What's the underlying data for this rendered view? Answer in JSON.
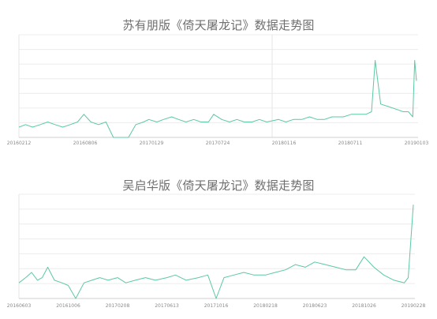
{
  "chart_data": [
    {
      "type": "line",
      "title": "苏有朋版《倚天屠龙记》数据走势图",
      "line_color": "#5cc8a4",
      "grid": "horizontal",
      "x_tick_labels": [
        "20160212",
        "20160806",
        "20170129",
        "20170724",
        "20180116",
        "20180711",
        "20190103"
      ],
      "x": [
        "20160212",
        "20160301",
        "20160320",
        "20160410",
        "20160430",
        "20160520",
        "20160610",
        "20160630",
        "20160720",
        "20160806",
        "20160825",
        "20160915",
        "20161005",
        "20161025",
        "20161115",
        "20161205",
        "20161225",
        "20170115",
        "20170129",
        "20170220",
        "20170310",
        "20170401",
        "20170420",
        "20170510",
        "20170531",
        "20170620",
        "20170710",
        "20170724",
        "20170815",
        "20170905",
        "20170925",
        "20171015",
        "20171105",
        "20171125",
        "20171215",
        "20180116",
        "20180205",
        "20180225",
        "20180320",
        "20180410",
        "20180501",
        "20180520",
        "20180610",
        "20180711",
        "20180801",
        "20180820",
        "20180910",
        "20180925",
        "20181005",
        "20181020",
        "20181110",
        "20181201",
        "20181220",
        "20190103",
        "20190115",
        "20190120",
        "20190125"
      ],
      "y": [
        4,
        5,
        4,
        5,
        6,
        5,
        4,
        5,
        6,
        9,
        6,
        5,
        6,
        0,
        0,
        0,
        5,
        6,
        7,
        6,
        7,
        8,
        7,
        6,
        7,
        6,
        6,
        9,
        7,
        6,
        7,
        6,
        6,
        7,
        6,
        7,
        6,
        7,
        7,
        8,
        7,
        7,
        8,
        8,
        9,
        9,
        9,
        10,
        30,
        13,
        12,
        11,
        10,
        10,
        8,
        30,
        22
      ]
    },
    {
      "type": "line",
      "title": "吴启华版《倚天屠龙记》数据走势图",
      "line_color": "#5cc8a4",
      "grid": "horizontal",
      "x_tick_labels": [
        "20160603",
        "20161006",
        "20170208",
        "20170613",
        "20171016",
        "20180218",
        "20180623",
        "20181026",
        "20190228"
      ],
      "x": [
        "20160603",
        "20160620",
        "20160705",
        "20160720",
        "20160801",
        "20160815",
        "20160901",
        "20160920",
        "20161006",
        "20161025",
        "20161115",
        "20161205",
        "20161225",
        "20170115",
        "20170208",
        "20170301",
        "20170325",
        "20170420",
        "20170515",
        "20170613",
        "20170705",
        "20170801",
        "20170901",
        "20170925",
        "20171016",
        "20171105",
        "20171130",
        "20171225",
        "20180120",
        "20180218",
        "20180315",
        "20180410",
        "20180505",
        "20180530",
        "20180623",
        "20180720",
        "20180815",
        "20180910",
        "20181005",
        "20181026",
        "20181120",
        "20181215",
        "20190110",
        "20190205",
        "20190215",
        "20190228"
      ],
      "y": [
        6,
        8,
        10,
        7,
        8,
        12,
        7,
        6,
        5,
        0,
        6,
        7,
        8,
        7,
        8,
        6,
        7,
        8,
        7,
        8,
        9,
        7,
        8,
        9,
        0,
        8,
        9,
        10,
        9,
        9,
        10,
        11,
        13,
        12,
        14,
        13,
        12,
        11,
        11,
        16,
        12,
        9,
        7,
        6,
        8,
        36
      ]
    }
  ]
}
